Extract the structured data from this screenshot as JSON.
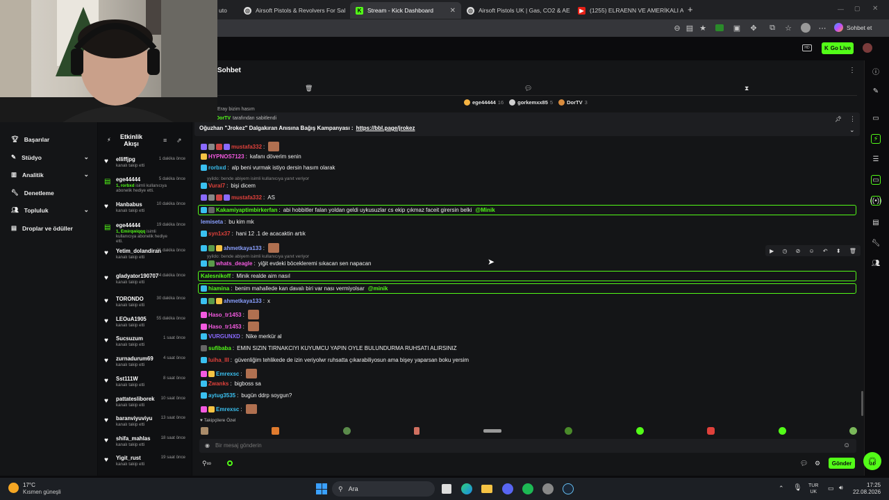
{
  "browser": {
    "tabs": [
      {
        "label": "Airsoft Pistols & Revolvers For Sal",
        "active": false
      },
      {
        "label": "Stream - Kick Dashboard",
        "active": true
      },
      {
        "label": "Airsoft Pistols UK | Gas, CO2 & AE",
        "active": false
      },
      {
        "label": "(1255) ELRAENN VE AMERİKALI A",
        "active": false
      }
    ],
    "tab_fragment": "uto",
    "profile_label": "Sohbet et"
  },
  "header": {
    "go_live": "Go Live",
    "hd_badge": "HD"
  },
  "left_nav": {
    "items": [
      {
        "label": "Başarılar",
        "icon": "trophy-icon",
        "has_chevron": false
      },
      {
        "label": "Stüdyo",
        "icon": "brush-icon",
        "has_chevron": true
      },
      {
        "label": "Analitik",
        "icon": "chart-icon",
        "has_chevron": true
      },
      {
        "label": "Denetleme",
        "icon": "wrench-icon",
        "has_chevron": false
      },
      {
        "label": "Topluluk",
        "icon": "people-icon",
        "has_chevron": true
      },
      {
        "label": "Droplar ve ödüller",
        "icon": "gift-icon",
        "has_chevron": false
      }
    ]
  },
  "activity": {
    "title_line1": "Etkinlik",
    "title_line2": "Akışı",
    "items": [
      {
        "name": "elliffjpg",
        "time": "1 dakika önce",
        "sub": "kanalı takip etti",
        "type": "follow"
      },
      {
        "name": "ege44444",
        "time": "5 dakika önce",
        "sub_count": "1, rorbxd",
        "sub": "isimli kullanıcıya abonelik hediye etti.",
        "type": "gift"
      },
      {
        "name": "Hanbabus",
        "time": "10 dakika önce",
        "sub": "kanalı takip etti",
        "type": "follow"
      },
      {
        "name": "ege44444",
        "time": "19 dakika önce",
        "sub_count": "1, Emirqwiqqq",
        "sub": "isimli kullanıcıya abonelik hediye etti.",
        "type": "gift"
      },
      {
        "name": "Yetim_dolandiran",
        "time": "21 dakika önce",
        "sub": "kanalı takip etti",
        "type": "follow"
      },
      {
        "name": "gladyator190707",
        "time": "24 dakika önce",
        "sub": "kanalı takip etti",
        "type": "follow"
      },
      {
        "name": "TORONDO",
        "time": "30 dakika önce",
        "sub": "kanalı takip etti",
        "type": "follow"
      },
      {
        "name": "LEOuA1905",
        "time": "55 dakika önce",
        "sub": "kanalı takip etti",
        "type": "follow"
      },
      {
        "name": "Sucsuzum",
        "time": "1 saat önce",
        "sub": "kanalı takip etti",
        "type": "follow"
      },
      {
        "name": "zurnadurum69",
        "time": "4 saat önce",
        "sub": "kanalı takip etti",
        "type": "follow"
      },
      {
        "name": "Sst111W",
        "time": "8 saat önce",
        "sub": "kanalı takip etti",
        "type": "follow"
      },
      {
        "name": "pattatesliborek",
        "time": "10 saat önce",
        "sub": "kanalı takip etti",
        "type": "follow"
      },
      {
        "name": "baranviyuviyu",
        "time": "13 saat önce",
        "sub": "kanalı takip etti",
        "type": "follow"
      },
      {
        "name": "shifa_mahlas",
        "time": "18 saat önce",
        "sub": "kanalı takip etti",
        "type": "follow"
      },
      {
        "name": "Yigit_rust",
        "time": "19 saat önce",
        "sub": "kanalı takip etti",
        "type": "follow"
      }
    ]
  },
  "chat": {
    "title": "Sohbet",
    "top_gifters": [
      {
        "name": "ege44444",
        "count": "16",
        "color": "#f5b342"
      },
      {
        "name": "gorkemxx85",
        "count": "5",
        "color": "#d0d0d0"
      },
      {
        "name": "DorTV",
        "count": "3",
        "color": "#d98c3e"
      }
    ],
    "prev_line": "Eray bizim hasım",
    "pinned_by": "DorTV",
    "pinned_by_suffix": "tarafından sabitlendi",
    "pinned_text": "Oğuzhan \"Jrokez\" Dalgakıran Anısına Bağış Kampanyası :",
    "pinned_link": "https://bbl.page/jrokez",
    "messages": [
      {
        "user": "mustafa332",
        "color": "#e0413b",
        "text": "",
        "emote": true
      },
      {
        "user": "HYPNOS7123",
        "color": "#f45ae0",
        "text": "kafanı döverim senin"
      },
      {
        "user": "rorbxd",
        "color": "#3ac0f0",
        "text": "alp beni vurmak istiyo dersin hasım olarak"
      },
      {
        "reply": "yyildo: bende abiyem isimli kullanıcıya yanıt veriyor"
      },
      {
        "user": "Vural7",
        "color": "#e0413b",
        "text": "bişi dicem"
      },
      {
        "user": "mustafa332",
        "color": "#e0413b",
        "text": "AS"
      },
      {
        "user": "Kakamiyaptimbirkerfan",
        "color": "#53fc18",
        "text": "abi hobbitler falan yoldan geldi uykusuzlar cs ekip çıkmaz faceit girersin belki",
        "mention": "@Minik",
        "highlight": true
      },
      {
        "user": "lemiseta",
        "color": "#8aa0ff",
        "text": "bu kim mk"
      },
      {
        "user": "syn1x37",
        "color": "#e0413b",
        "text": "hani 12 .1 de acacaktin artık"
      },
      {
        "user": "ahmetkaya133",
        "color": "#8aa0ff",
        "text": "",
        "emote": true
      },
      {
        "reply": "yyildo: bende abiyem isimli kullanıcıya yanıt veriyor"
      },
      {
        "user": "whats_deagle",
        "color": "#f45ae0",
        "text": "yiğit evdeki böcekleremi sıkacan sen napacan"
      },
      {
        "user": "Kalesnikoff",
        "color": "#53fc18",
        "text": "Minik realde aim nasıl",
        "highlight": true
      },
      {
        "user": "hiamina",
        "color": "#53fc18",
        "text": "benim mahallede kan davalı biri var nası vermiyolsar",
        "mention": "@minik",
        "highlight": true
      },
      {
        "user": "ahmetkaya133",
        "color": "#8aa0ff",
        "text": "x"
      },
      {
        "user": "Haso_tr1453",
        "color": "#f45ae0",
        "text": "",
        "emote": true
      },
      {
        "user": "Haso_tr1453",
        "color": "#f45ae0",
        "text": "",
        "emote": true
      },
      {
        "user": "VURGUNXD",
        "color": "#8a6aff",
        "text": "Nike merkür al"
      },
      {
        "user": "sufibaba",
        "color": "#53fc18",
        "text": "EMIN SIZIN TIRNAKCIYI KUYUMCU YAPIN OYLE BULUNDURMA RUHSATI ALIRSINIZ"
      },
      {
        "user": "luiha_III",
        "color": "#e0413b",
        "text": "güvenliğim tehlikede de izin veriyolwr ruhsatta çıkarabiliyosun ama bişey yaparsan boku yersim"
      },
      {
        "user": "Emrexsc",
        "color": "#3ac0f0",
        "text": "",
        "emote": true
      },
      {
        "user": "Zwanks",
        "color": "#e0413b",
        "text": "bigboss sa"
      },
      {
        "user": "aytug3535",
        "color": "#3ac0f0",
        "text": "bugün ddrp soygun?"
      },
      {
        "user": "Emrexsc",
        "color": "#3ac0f0",
        "text": "",
        "emote": true
      }
    ],
    "emote_bar_label": "Takipçilere Özel",
    "input_placeholder": "Bir mesaj gönderin",
    "send_label": "Gönder"
  },
  "taskbar": {
    "weather_temp": "17°C",
    "weather_text": "Kısmen güneşli",
    "search_label": "Ara",
    "lang_top": "TUR",
    "lang_bottom": "UK",
    "time": "17:25",
    "date": "22.08.2026"
  }
}
